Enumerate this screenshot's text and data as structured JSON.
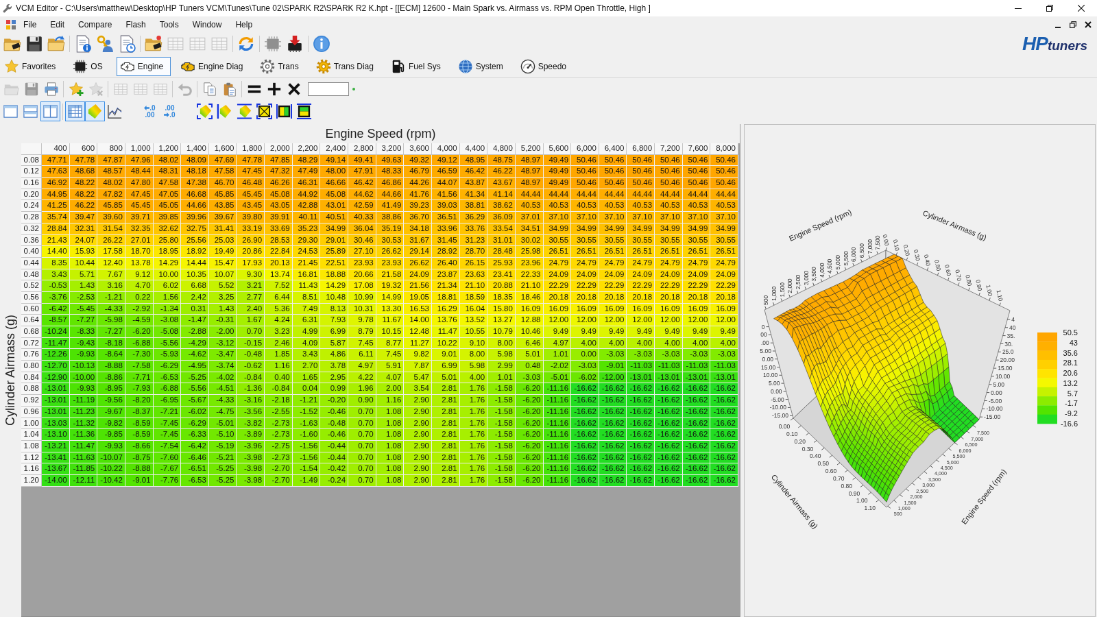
{
  "window": {
    "title": "VCM Editor - C:\\Users\\matthew\\Desktop\\HP Tuners VCM\\Tunes\\Tune 02\\SPARK R2\\SPARK R2 K.hpt - [[ECM] 12600 - Main Spark vs. Airmass vs. RPM Open Throttle, High ]"
  },
  "menu": [
    "File",
    "Edit",
    "Compare",
    "Flash",
    "Tools",
    "Window",
    "Help"
  ],
  "toolbar_main": [
    [
      {
        "kind": "folder-chip",
        "disabled": false
      },
      {
        "kind": "floppy",
        "disabled": false
      },
      {
        "kind": "folder-arrow",
        "disabled": false
      }
    ],
    [
      {
        "kind": "doc-info",
        "disabled": false
      },
      {
        "kind": "user-key",
        "disabled": false
      },
      {
        "kind": "doc-clock",
        "disabled": false
      }
    ],
    [
      {
        "kind": "folder-spark",
        "disabled": false
      },
      {
        "kind": "grid",
        "disabled": true
      },
      {
        "kind": "grid",
        "disabled": true
      },
      {
        "kind": "grid",
        "disabled": true
      }
    ],
    [
      {
        "kind": "convert",
        "disabled": false
      }
    ],
    [
      {
        "kind": "chip",
        "disabled": true
      },
      {
        "kind": "chip-download",
        "disabled": false
      }
    ],
    [
      {
        "kind": "info",
        "disabled": false
      }
    ]
  ],
  "logo": {
    "mark": "HP",
    "name": "tuners"
  },
  "categories": [
    {
      "label": "Favorites",
      "kind": "star",
      "selected": false
    },
    {
      "label": "OS",
      "kind": "chip",
      "selected": false
    },
    {
      "label": "Engine",
      "kind": "engine",
      "selected": true
    },
    {
      "label": "Engine Diag",
      "kind": "engine-warning",
      "selected": false
    },
    {
      "label": "Trans",
      "kind": "gear",
      "selected": false
    },
    {
      "label": "Trans Diag",
      "kind": "gear-yellow",
      "selected": false
    },
    {
      "label": "Fuel Sys",
      "kind": "fuel",
      "selected": false
    },
    {
      "label": "System",
      "kind": "globe",
      "selected": false
    },
    {
      "label": "Speedo",
      "kind": "speedometer",
      "selected": false
    }
  ],
  "edit_toolbar": [
    [
      {
        "kind": "folder",
        "disabled": true
      },
      {
        "kind": "floppy",
        "disabled": true
      },
      {
        "kind": "printer",
        "disabled": false
      }
    ],
    [
      {
        "kind": "star-plus",
        "disabled": false
      },
      {
        "kind": "star-x",
        "disabled": true
      }
    ],
    [
      {
        "kind": "grid",
        "disabled": true
      },
      {
        "kind": "grid",
        "disabled": true
      },
      {
        "kind": "grid",
        "disabled": true
      }
    ],
    [
      {
        "kind": "undo",
        "disabled": true
      }
    ],
    [
      {
        "kind": "copy",
        "disabled": false
      },
      {
        "kind": "paste",
        "disabled": false
      }
    ],
    [
      {
        "kind": "equals",
        "disabled": false
      },
      {
        "kind": "plus",
        "disabled": false
      },
      {
        "kind": "times",
        "disabled": false
      },
      {
        "kind": "input",
        "disabled": false
      },
      {
        "kind": "dot",
        "disabled": false
      }
    ]
  ],
  "view_toolbar": [
    [
      {
        "kind": "pane-single",
        "pressed": false
      },
      {
        "kind": "pane-rows",
        "pressed": false
      },
      {
        "kind": "pane-columns",
        "pressed": true
      }
    ],
    [
      {
        "kind": "table-view",
        "pressed": true
      },
      {
        "kind": "surface-view",
        "pressed": true
      },
      {
        "kind": "line-chart",
        "pressed": false
      }
    ],
    [
      {
        "kind": "decimals-less",
        "labels": [
          ".0",
          ".00"
        ],
        "pressed": false
      },
      {
        "kind": "decimals-more",
        "labels": [
          ".00",
          ".0"
        ],
        "pressed": false
      }
    ],
    [
      {
        "kind": "fit-all",
        "pressed": false
      },
      {
        "kind": "fit-left",
        "pressed": false
      },
      {
        "kind": "fit-top",
        "pressed": false
      },
      {
        "kind": "zoom-box",
        "pressed": false
      },
      {
        "kind": "split-left",
        "pressed": false
      },
      {
        "kind": "split-top",
        "pressed": false
      }
    ]
  ],
  "table": {
    "column_axis": "Engine Speed (rpm)",
    "row_axis": "Cylinder Airmass (g)",
    "columns": [
      "400",
      "600",
      "800",
      "1,000",
      "1,200",
      "1,400",
      "1,600",
      "1,800",
      "2,000",
      "2,200",
      "2,400",
      "2,800",
      "3,200",
      "3,600",
      "4,000",
      "4,400",
      "4,800",
      "5,200",
      "5,600",
      "6,000",
      "6,400",
      "6,800",
      "7,200",
      "7,600",
      "8,000"
    ],
    "rows": [
      {
        "label": "0.08",
        "cells": [
          "47.71",
          "47.78",
          "47.87",
          "47.96",
          "48.02",
          "48.09",
          "47.69",
          "47.78",
          "47.85",
          "48.29",
          "49.14",
          "49.41",
          "49.63",
          "49.32",
          "49.12",
          "48.95",
          "48.75",
          "48.97",
          "49.49",
          "50.46",
          "50.46",
          "50.46",
          "50.46",
          "50.46",
          "50.46"
        ]
      },
      {
        "label": "0.12",
        "cells": [
          "47.63",
          "48.68",
          "48.57",
          "48.44",
          "48.31",
          "48.18",
          "47.58",
          "47.45",
          "47.32",
          "47.49",
          "48.00",
          "47.91",
          "48.33",
          "46.79",
          "46.59",
          "46.42",
          "46.22",
          "48.97",
          "49.49",
          "50.46",
          "50.46",
          "50.46",
          "50.46",
          "50.46",
          "50.46"
        ]
      },
      {
        "label": "0.16",
        "cells": [
          "46.92",
          "48.22",
          "48.02",
          "47.80",
          "47.58",
          "47.38",
          "46.70",
          "46.48",
          "46.26",
          "46.31",
          "46.66",
          "46.42",
          "46.86",
          "44.26",
          "44.07",
          "43.87",
          "43.67",
          "48.97",
          "49.49",
          "50.46",
          "50.46",
          "50.46",
          "50.46",
          "50.46",
          "50.46"
        ]
      },
      {
        "label": "0.20",
        "cells": [
          "44.95",
          "48.22",
          "47.82",
          "47.45",
          "47.05",
          "46.68",
          "45.85",
          "45.45",
          "45.08",
          "44.92",
          "45.08",
          "44.62",
          "44.66",
          "41.76",
          "41.56",
          "41.34",
          "41.14",
          "44.44",
          "44.44",
          "44.44",
          "44.44",
          "44.44",
          "44.44",
          "44.44",
          "44.44"
        ]
      },
      {
        "label": "0.24",
        "cells": [
          "41.25",
          "46.22",
          "45.85",
          "45.45",
          "45.05",
          "44.66",
          "43.85",
          "43.45",
          "43.05",
          "42.88",
          "43.01",
          "42.59",
          "41.49",
          "39.23",
          "39.03",
          "38.81",
          "38.62",
          "40.53",
          "40.53",
          "40.53",
          "40.53",
          "40.53",
          "40.53",
          "40.53",
          "40.53"
        ]
      },
      {
        "label": "0.28",
        "cells": [
          "35.74",
          "39.47",
          "39.60",
          "39.71",
          "39.85",
          "39.96",
          "39.67",
          "39.80",
          "39.91",
          "40.11",
          "40.51",
          "40.33",
          "38.86",
          "36.70",
          "36.51",
          "36.29",
          "36.09",
          "37.01",
          "37.10",
          "37.10",
          "37.10",
          "37.10",
          "37.10",
          "37.10",
          "37.10"
        ]
      },
      {
        "label": "0.32",
        "cells": [
          "28.84",
          "32.31",
          "31.54",
          "32.35",
          "32.62",
          "32.75",
          "31.41",
          "33.19",
          "33.69",
          "35.23",
          "34.99",
          "36.04",
          "35.19",
          "34.18",
          "33.96",
          "33.76",
          "33.54",
          "34.51",
          "34.99",
          "34.99",
          "34.99",
          "34.99",
          "34.99",
          "34.99",
          "34.99"
        ]
      },
      {
        "label": "0.36",
        "cells": [
          "21.43",
          "24.07",
          "26.22",
          "27.01",
          "25.80",
          "25.56",
          "25.03",
          "26.90",
          "28.53",
          "29.30",
          "29.01",
          "30.46",
          "30.53",
          "31.67",
          "31.45",
          "31.23",
          "31.01",
          "30.02",
          "30.55",
          "30.55",
          "30.55",
          "30.55",
          "30.55",
          "30.55",
          "30.55"
        ]
      },
      {
        "label": "0.40",
        "cells": [
          "14.40",
          "15.93",
          "17.58",
          "18.70",
          "18.95",
          "18.92",
          "19.49",
          "20.86",
          "22.84",
          "24.53",
          "25.89",
          "27.10",
          "26.62",
          "29.14",
          "28.92",
          "28.70",
          "28.48",
          "25.98",
          "26.51",
          "26.51",
          "26.51",
          "26.51",
          "26.51",
          "26.51",
          "26.51"
        ]
      },
      {
        "label": "0.44",
        "cells": [
          "8.35",
          "10.44",
          "12.40",
          "13.78",
          "14.29",
          "14.44",
          "15.47",
          "17.93",
          "20.13",
          "21.45",
          "22.51",
          "23.93",
          "23.93",
          "26.62",
          "26.40",
          "26.15",
          "25.93",
          "23.96",
          "24.79",
          "24.79",
          "24.79",
          "24.79",
          "24.79",
          "24.79",
          "24.79"
        ]
      },
      {
        "label": "0.48",
        "cells": [
          "3.43",
          "5.71",
          "7.67",
          "9.12",
          "10.00",
          "10.35",
          "10.07",
          "9.30",
          "13.74",
          "16.81",
          "18.88",
          "20.66",
          "21.58",
          "24.09",
          "23.87",
          "23.63",
          "23.41",
          "22.33",
          "24.09",
          "24.09",
          "24.09",
          "24.09",
          "24.09",
          "24.09",
          "24.09"
        ]
      },
      {
        "label": "0.52",
        "cells": [
          "-0.53",
          "1.43",
          "3.16",
          "4.70",
          "6.02",
          "6.68",
          "5.52",
          "3.21",
          "7.52",
          "11.43",
          "14.29",
          "17.08",
          "19.32",
          "21.56",
          "21.34",
          "21.10",
          "20.88",
          "21.10",
          "22.29",
          "22.29",
          "22.29",
          "22.29",
          "22.29",
          "22.29",
          "22.29"
        ]
      },
      {
        "label": "0.56",
        "cells": [
          "-3.76",
          "-2.53",
          "-1.21",
          "0.22",
          "1.56",
          "2.42",
          "3.25",
          "2.77",
          "6.44",
          "8.51",
          "10.48",
          "10.99",
          "14.99",
          "19.05",
          "18.81",
          "18.59",
          "18.35",
          "18.46",
          "20.18",
          "20.18",
          "20.18",
          "20.18",
          "20.18",
          "20.18",
          "20.18"
        ]
      },
      {
        "label": "0.60",
        "cells": [
          "-6.42",
          "-5.45",
          "-4.33",
          "-2.92",
          "-1.34",
          "0.31",
          "1.43",
          "2.40",
          "5.36",
          "7.49",
          "8.13",
          "10.31",
          "13.30",
          "16.53",
          "16.29",
          "16.04",
          "15.80",
          "16.09",
          "16.09",
          "16.09",
          "16.09",
          "16.09",
          "16.09",
          "16.09",
          "16.09"
        ]
      },
      {
        "label": "0.64",
        "cells": [
          "-8.57",
          "-7.27",
          "-5.98",
          "-4.59",
          "-3.08",
          "-1.47",
          "-0.31",
          "1.67",
          "4.24",
          "6.31",
          "7.93",
          "9.78",
          "11.67",
          "14.00",
          "13.76",
          "13.52",
          "13.27",
          "12.88",
          "12.00",
          "12.00",
          "12.00",
          "12.00",
          "12.00",
          "12.00",
          "12.00"
        ]
      },
      {
        "label": "0.68",
        "cells": [
          "-10.24",
          "-8.33",
          "-7.27",
          "-6.20",
          "-5.08",
          "-2.88",
          "-2.00",
          "0.70",
          "3.23",
          "4.99",
          "6.99",
          "8.79",
          "10.15",
          "12.48",
          "11.47",
          "10.55",
          "10.79",
          "10.46",
          "9.49",
          "9.49",
          "9.49",
          "9.49",
          "9.49",
          "9.49",
          "9.49"
        ]
      },
      {
        "label": "0.72",
        "cells": [
          "-11.47",
          "-9.43",
          "-8.18",
          "-6.88",
          "-5.56",
          "-4.29",
          "-3.12",
          "-0.15",
          "2.46",
          "4.09",
          "5.87",
          "7.45",
          "8.77",
          "11.27",
          "10.22",
          "9.10",
          "8.00",
          "6.46",
          "4.97",
          "4.00",
          "4.00",
          "4.00",
          "4.00",
          "4.00",
          "4.00"
        ]
      },
      {
        "label": "0.76",
        "cells": [
          "-12.26",
          "-9.93",
          "-8.64",
          "-7.30",
          "-5.93",
          "-4.62",
          "-3.47",
          "-0.48",
          "1.85",
          "3.43",
          "4.86",
          "6.11",
          "7.45",
          "9.82",
          "9.01",
          "8.00",
          "5.98",
          "5.01",
          "1.01",
          "0.00",
          "-3.03",
          "-3.03",
          "-3.03",
          "-3.03",
          "-3.03"
        ]
      },
      {
        "label": "0.80",
        "cells": [
          "-12.70",
          "-10.13",
          "-8.88",
          "-7.58",
          "-6.29",
          "-4.95",
          "-3.74",
          "-0.62",
          "1.16",
          "2.70",
          "3.78",
          "4.97",
          "5.91",
          "7.87",
          "6.99",
          "5.98",
          "2.99",
          "0.48",
          "-2.02",
          "-3.03",
          "-9.01",
          "-11.03",
          "-11.03",
          "-11.03",
          "-11.03"
        ]
      },
      {
        "label": "0.84",
        "cells": [
          "-12.90",
          "-10.00",
          "-8.86",
          "-7.71",
          "-6.53",
          "-5.25",
          "-4.02",
          "-0.84",
          "0.40",
          "1.65",
          "2.95",
          "4.22",
          "4.07",
          "5.47",
          "5.01",
          "4.00",
          "1.01",
          "-3.03",
          "-5.01",
          "-6.02",
          "-12.00",
          "-13.01",
          "-13.01",
          "-13.01",
          "-13.01"
        ]
      },
      {
        "label": "0.88",
        "cells": [
          "-13.01",
          "-9.93",
          "-8.95",
          "-7.93",
          "-6.88",
          "-5.56",
          "-4.51",
          "-1.36",
          "-0.84",
          "0.04",
          "0.99",
          "1.96",
          "2.00",
          "3.54",
          "2.81",
          "1.76",
          "-1.58",
          "-6.20",
          "-11.16",
          "-16.62",
          "-16.62",
          "-16.62",
          "-16.62",
          "-16.62",
          "-16.62"
        ]
      },
      {
        "label": "0.92",
        "cells": [
          "-13.01",
          "-11.19",
          "-9.56",
          "-8.20",
          "-6.95",
          "-5.67",
          "-4.33",
          "-3.16",
          "-2.18",
          "-1.21",
          "-0.20",
          "0.90",
          "1.16",
          "2.90",
          "2.81",
          "1.76",
          "-1.58",
          "-6.20",
          "-11.16",
          "-16.62",
          "-16.62",
          "-16.62",
          "-16.62",
          "-16.62",
          "-16.62"
        ]
      },
      {
        "label": "0.96",
        "cells": [
          "-13.01",
          "-11.23",
          "-9.67",
          "-8.37",
          "-7.21",
          "-6.02",
          "-4.75",
          "-3.56",
          "-2.55",
          "-1.52",
          "-0.46",
          "0.70",
          "1.08",
          "2.90",
          "2.81",
          "1.76",
          "-1.58",
          "-6.20",
          "-11.16",
          "-16.62",
          "-16.62",
          "-16.62",
          "-16.62",
          "-16.62",
          "-16.62"
        ]
      },
      {
        "label": "1.00",
        "cells": [
          "-13.03",
          "-11.32",
          "-9.82",
          "-8.59",
          "-7.45",
          "-6.29",
          "-5.01",
          "-3.82",
          "-2.73",
          "-1.63",
          "-0.48",
          "0.70",
          "1.08",
          "2.90",
          "2.81",
          "1.76",
          "-1.58",
          "-6.20",
          "-11.16",
          "-16.62",
          "-16.62",
          "-16.62",
          "-16.62",
          "-16.62",
          "-16.62"
        ]
      },
      {
        "label": "1.04",
        "cells": [
          "-13.10",
          "-11.36",
          "-9.85",
          "-8.59",
          "-7.45",
          "-6.33",
          "-5.10",
          "-3.89",
          "-2.73",
          "-1.60",
          "-0.46",
          "0.70",
          "1.08",
          "2.90",
          "2.81",
          "1.76",
          "-1.58",
          "-6.20",
          "-11.16",
          "-16.62",
          "-16.62",
          "-16.62",
          "-16.62",
          "-16.62",
          "-16.62"
        ]
      },
      {
        "label": "1.08",
        "cells": [
          "-13.21",
          "-11.47",
          "-9.93",
          "-8.66",
          "-7.54",
          "-6.42",
          "-5.19",
          "-3.96",
          "-2.75",
          "-1.56",
          "-0.44",
          "0.70",
          "1.08",
          "2.90",
          "2.81",
          "1.76",
          "-1.58",
          "-6.20",
          "-11.16",
          "-16.62",
          "-16.62",
          "-16.62",
          "-16.62",
          "-16.62",
          "-16.62"
        ]
      },
      {
        "label": "1.12",
        "cells": [
          "-13.41",
          "-11.63",
          "-10.07",
          "-8.75",
          "-7.60",
          "-6.46",
          "-5.21",
          "-3.98",
          "-2.73",
          "-1.56",
          "-0.44",
          "0.70",
          "1.08",
          "2.90",
          "2.81",
          "1.76",
          "-1.58",
          "-6.20",
          "-11.16",
          "-16.62",
          "-16.62",
          "-16.62",
          "-16.62",
          "-16.62",
          "-16.62"
        ]
      },
      {
        "label": "1.16",
        "cells": [
          "-13.67",
          "-11.85",
          "-10.22",
          "-8.88",
          "-7.67",
          "-6.51",
          "-5.25",
          "-3.98",
          "-2.70",
          "-1.54",
          "-0.42",
          "0.70",
          "1.08",
          "2.90",
          "2.81",
          "1.76",
          "-1.58",
          "-6.20",
          "-11.16",
          "-16.62",
          "-16.62",
          "-16.62",
          "-16.62",
          "-16.62",
          "-16.62"
        ]
      },
      {
        "label": "1.20",
        "cells": [
          "-14.00",
          "-12.11",
          "-10.42",
          "-9.01",
          "-7.76",
          "-6.53",
          "-5.25",
          "-3.98",
          "-2.70",
          "-1.49",
          "-0.24",
          "0.70",
          "1.08",
          "2.90",
          "2.81",
          "1.76",
          "-1.58",
          "-6.20",
          "-11.16",
          "-16.62",
          "-16.62",
          "-16.62",
          "-16.62",
          "-16.62",
          "-16.62"
        ]
      }
    ]
  },
  "graph": {
    "axes": [
      {
        "kind": "top-left",
        "title": "Engine Speed (rpm)",
        "ticks": [
          "500",
          "1,000",
          "1,500",
          "2,000",
          "2,500",
          "3,000",
          "3,500",
          "4,000",
          "4,500",
          "5,000",
          "5,500",
          "6,000",
          "6,500",
          "7,000",
          "7,500"
        ]
      },
      {
        "kind": "top-right",
        "title": "Cylinder Airmass (g)",
        "ticks": [
          "0.00",
          "0.10",
          "0.20",
          "0.30",
          "0.40",
          "0.50",
          "0.60",
          "0.70",
          "0.80",
          "0.90",
          "1.00",
          "1.10"
        ]
      },
      {
        "kind": "bottom-left",
        "title": "Cylinder Airmass (g)",
        "ticks": [
          "0.00",
          "0.10",
          "0.20",
          "0.30",
          "0.40",
          "0.50",
          "0.60",
          "0.70",
          "0.80",
          "0.90",
          "1.00",
          "1.10"
        ]
      },
      {
        "kind": "bottom-right",
        "title": "Engine Speed (rpm)",
        "ticks": [
          "500",
          "1,000",
          "1,500",
          "2,000",
          "2,500",
          "3,000",
          "3,500",
          "4,000",
          "4,500",
          "5,000",
          "5,500",
          "6,000",
          "6,500",
          "7,000",
          "7,500"
        ]
      }
    ],
    "z_axes": [
      {
        "kind": "left",
        "ticks": [
          "0",
          "00",
          ".00",
          "5.00",
          "0.00",
          "15.00",
          "10.00",
          "5.00",
          "0.00",
          "-5.00",
          "-10.00",
          "-15.00"
        ]
      },
      {
        "kind": "right",
        "ticks": [
          "4",
          "40",
          "35.",
          "30.",
          "25.0",
          "20.00",
          "15.00",
          "10.00",
          "5.00",
          "0.00",
          "-5.00",
          "-10.00",
          "-15.00"
        ]
      }
    ],
    "legend": [
      {
        "label": "50.5",
        "color": "#ffa600"
      },
      {
        "label": "43",
        "color": "#ffb000"
      },
      {
        "label": "35.6",
        "color": "#ffbf00"
      },
      {
        "label": "28.1",
        "color": "#ffd000"
      },
      {
        "label": "20.6",
        "color": "#ffe400"
      },
      {
        "label": "13.2",
        "color": "#f4f800"
      },
      {
        "label": "5.7",
        "color": "#c6f200"
      },
      {
        "label": "-1.7",
        "color": "#8cec00"
      },
      {
        "label": "-9.2",
        "color": "#52e400"
      },
      {
        "label": "-16.6",
        "color": "#22dd22"
      }
    ]
  }
}
